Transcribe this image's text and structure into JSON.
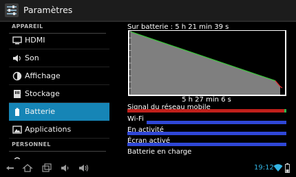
{
  "actionbar": {
    "title": "Paramètres"
  },
  "sidebar": {
    "section_device": "APPAREIL",
    "section_personal": "PERSONNEL",
    "items": [
      {
        "label": "HDMI",
        "icon": "monitor-icon"
      },
      {
        "label": "Son",
        "icon": "speaker-icon"
      },
      {
        "label": "Affichage",
        "icon": "brightness-icon"
      },
      {
        "label": "Stockage",
        "icon": "storage-icon"
      },
      {
        "label": "Batterie",
        "icon": "battery-icon"
      },
      {
        "label": "Applications",
        "icon": "applications-icon"
      }
    ],
    "active_index": 4
  },
  "battery": {
    "status_text": "Sur batterie : 5 h 21 min 39 s",
    "chart_time_label": "5 h 27 min 6 s",
    "level_start": 1.0,
    "level_end": 0.13
  },
  "history": [
    {
      "label": "Signal du réseau mobile",
      "color": "#c0201b"
    },
    {
      "label": "Wi-Fi",
      "color": "#2f47d6"
    },
    {
      "label": "En activité",
      "color": "#2f47d6"
    },
    {
      "label": "Écran activé",
      "color": "#2f47d6"
    },
    {
      "label": "Batterie en charge",
      "color": "#2f47d6"
    }
  ],
  "statusbar": {
    "time": "19:12"
  },
  "colors": {
    "accent": "#1685b6",
    "holo_blue": "#33b5e5",
    "battery_line": "#3cc43c"
  }
}
